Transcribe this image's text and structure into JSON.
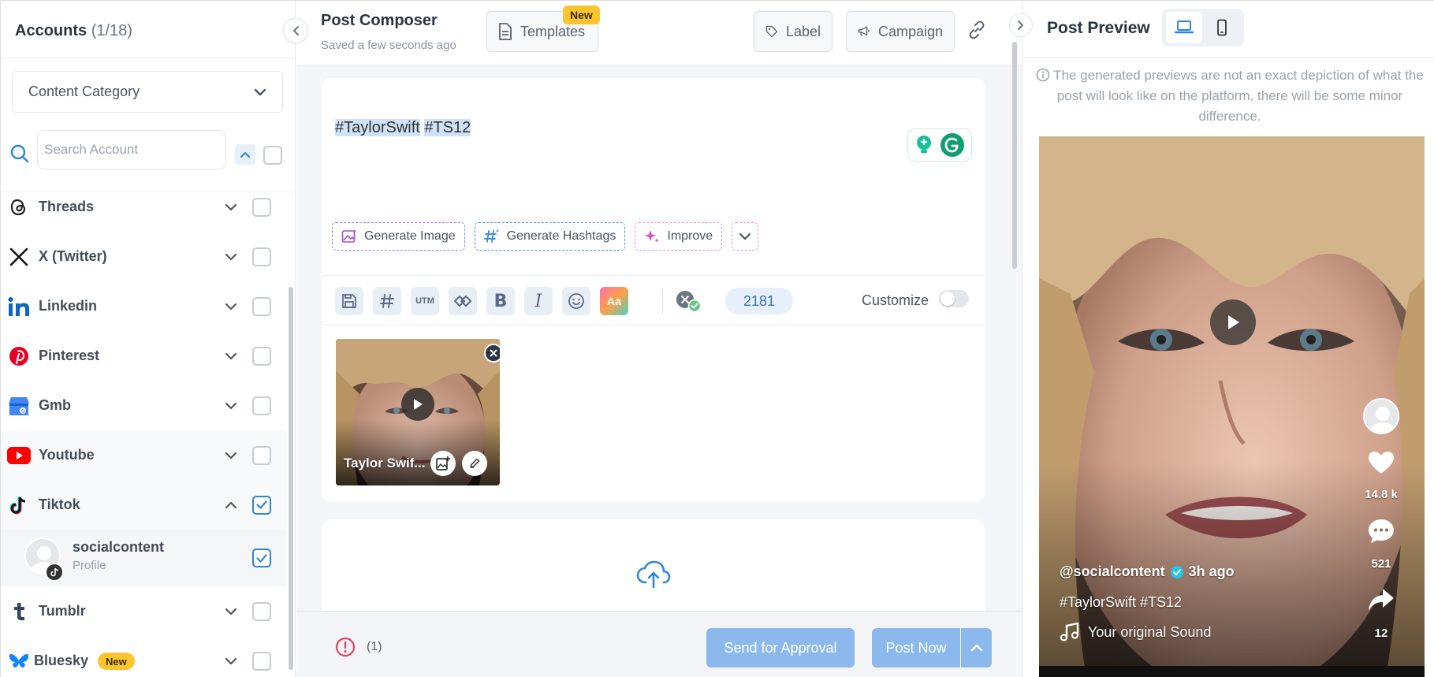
{
  "sidebar": {
    "title": "Accounts",
    "count": "(1/18)",
    "category_placeholder": "Content Category",
    "search_placeholder": "Search Account",
    "platforms": [
      {
        "name": "Threads",
        "checked": false
      },
      {
        "name": "X (Twitter)",
        "checked": false
      },
      {
        "name": "Linkedin",
        "checked": false
      },
      {
        "name": "Pinterest",
        "checked": false
      },
      {
        "name": "Gmb",
        "checked": false
      },
      {
        "name": "Youtube",
        "checked": false
      },
      {
        "name": "Tiktok",
        "checked": true,
        "expanded": true
      },
      {
        "name": "Tumblr",
        "checked": false
      },
      {
        "name": "Bluesky",
        "checked": false,
        "badge": "New"
      }
    ],
    "profile": {
      "name": "socialcontent",
      "type": "Profile",
      "checked": true
    }
  },
  "composer": {
    "title": "Post Composer",
    "saved": "Saved a few seconds ago",
    "templates_label": "Templates",
    "templates_badge": "New",
    "label_label": "Label",
    "campaign_label": "Campaign",
    "text_plain": "#TaylorSwift",
    "text_highlight": "#TS12",
    "ai_buttons": {
      "generate_image": "Generate Image",
      "generate_hashtags": "Generate Hashtags",
      "improve": "Improve"
    },
    "toolbar": {
      "utm": "UTM",
      "bold": "B",
      "italic": "I",
      "font": "Aa"
    },
    "char_count": "2181",
    "customize_label": "Customize",
    "customize_on": false,
    "media": {
      "name": "Taylor Swif..."
    },
    "error_count": "(1)",
    "approval_label": "Send for Approval",
    "post_now_label": "Post Now"
  },
  "preview": {
    "title": "Post Preview",
    "note": "The generated previews are not an exact depiction of what the post will look like on the platform, there will be some minor difference.",
    "username": "@socialcontent",
    "time": "3h ago",
    "tags": "#TaylorSwift #TS12",
    "sound": "Your original Sound",
    "likes": "14.8 k",
    "comments": "521",
    "shares": "12"
  },
  "colors": {
    "accent": "#2f86d9",
    "primary_button": "#8cb9ec",
    "badge": "#fcc52d",
    "error": "#e0435c"
  }
}
